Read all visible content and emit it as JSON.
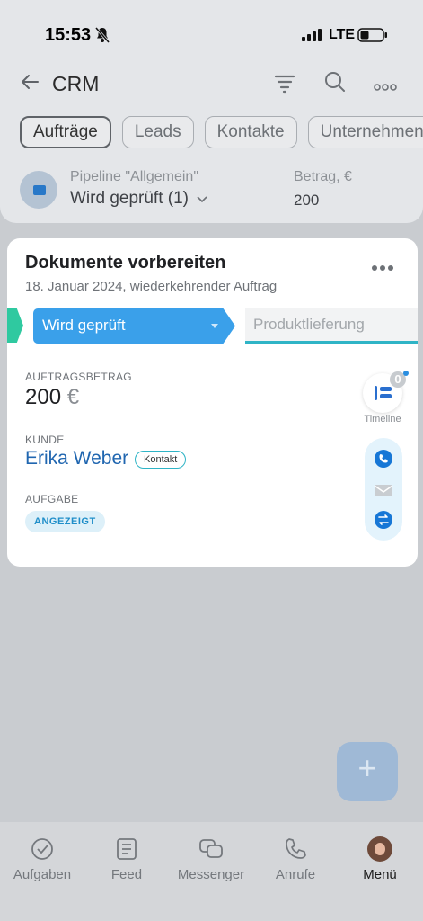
{
  "status_bar": {
    "time": "15:53",
    "network": "LTE"
  },
  "header": {
    "title": "CRM"
  },
  "tabs": [
    "Aufträge",
    "Leads",
    "Kontakte",
    "Unternehmen"
  ],
  "pipeline": {
    "label": "Pipeline \"Allgemein\"",
    "value": "Wird geprüft (1)",
    "amount_label": "Betrag, €",
    "amount_value": "200"
  },
  "card": {
    "title": "Dokumente vorbereiten",
    "subtitle": "18. Januar 2024, wiederkehrender Auftrag",
    "current_stage": "Wird geprüft",
    "next_stage": "Produktlieferung",
    "amount_label": "AUFTRAGSBETRAG",
    "amount": "200",
    "currency": "€",
    "client_label": "KUNDE",
    "client_name": "Erika Weber",
    "client_badge": "Kontakt",
    "task_label": "AUFGABE",
    "task_badge": "ANGEZEIGT",
    "timeline_count": "0",
    "timeline_label": "Timeline"
  },
  "fab": {
    "label": "+"
  },
  "bottom_nav": [
    {
      "label": "Aufgaben",
      "icon": "check-circle-icon"
    },
    {
      "label": "Feed",
      "icon": "feed-icon"
    },
    {
      "label": "Messenger",
      "icon": "chat-icon"
    },
    {
      "label": "Anrufe",
      "icon": "phone-icon"
    },
    {
      "label": "Menü",
      "icon": "avatar-icon"
    }
  ],
  "colors": {
    "accent": "#3aa0ea",
    "link": "#2066b0",
    "stage_prev": "#2fc9a0",
    "stage_next_line": "#2fb4c6"
  }
}
